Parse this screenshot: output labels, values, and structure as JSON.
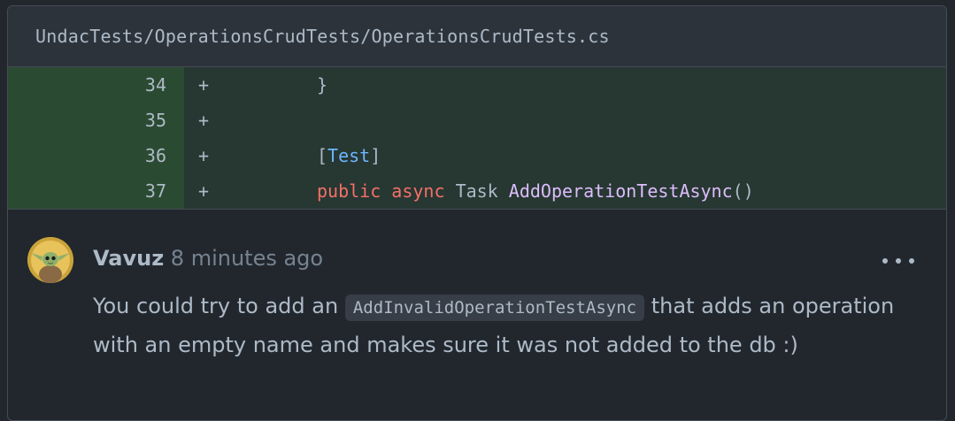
{
  "file": {
    "path": "UndacTests/OperationsCrudTests/OperationsCrudTests.cs"
  },
  "diff": {
    "lines": [
      {
        "num": "34",
        "marker": "+",
        "code": "}"
      },
      {
        "num": "35",
        "marker": "+",
        "code": ""
      },
      {
        "num": "36",
        "marker": "+",
        "code_parts": [
          "[",
          "Test",
          "]"
        ]
      },
      {
        "num": "37",
        "marker": "+",
        "code_parts": [
          "public",
          "async",
          "Task",
          "AddOperationTestAsync",
          "()"
        ]
      }
    ]
  },
  "comment": {
    "author": "Vavuz",
    "time": "8 minutes ago",
    "avatar_icon": "baby-yoda-avatar",
    "body_before": "You could try to add an ",
    "body_code": "AddInvalidOperationTestAsync",
    "body_after": " that adds an operation with an empty name and makes sure it was not added to the db :)"
  },
  "colors": {
    "background": "#22272e",
    "added_line": "#273732",
    "added_gutter": "#2b4a32",
    "keyword": "#f47067",
    "attribute": "#6cb6ff",
    "method": "#dcbdfb"
  }
}
